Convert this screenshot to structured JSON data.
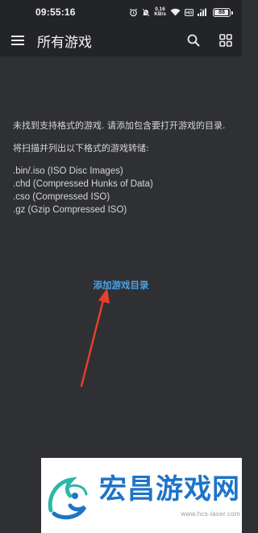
{
  "status_bar": {
    "time": "09:55:16",
    "net_speed_value": "0.16",
    "net_speed_unit": "KB/s",
    "battery": "88",
    "icons": [
      "alarm-icon",
      "mute-icon",
      "wifi-icon",
      "hd-icon",
      "signal-icon",
      "battery-icon"
    ]
  },
  "app_bar": {
    "title": "所有游戏",
    "icons": [
      "menu-icon",
      "search-icon",
      "grid-view-icon"
    ]
  },
  "empty_state": {
    "message": "未找到支持格式的游戏. 请添加包含要打开游戏的目录.",
    "scan_intro": "将扫描并列出以下格式的游戏转储:",
    "formats": [
      ".bin/.iso (ISO Disc Images)",
      ".chd (Compressed Hunks of Data)",
      ".cso (Compressed ISO)",
      ".gz (Gzip Compressed ISO)"
    ],
    "add_directory_label": "添加游戏目录"
  },
  "watermark": {
    "title": "宏昌游戏网",
    "url": "www.hcs-laser.com"
  },
  "colors": {
    "background": "#2f3034",
    "app_bar": "#232427",
    "accent_link": "#4aa3e8",
    "annotation_arrow": "#e8402a",
    "watermark_blue": "#1e74c7"
  }
}
